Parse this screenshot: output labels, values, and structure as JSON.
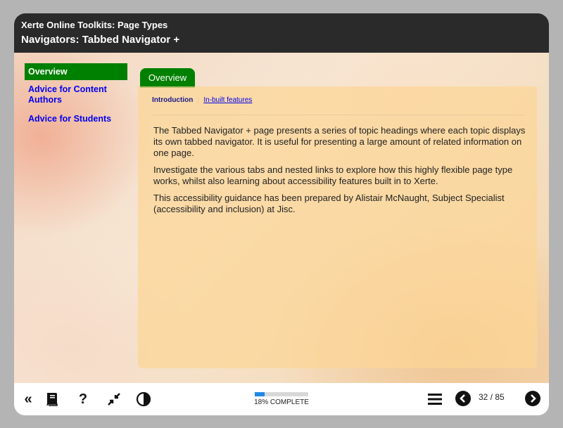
{
  "header": {
    "subtitle": "Xerte Online Toolkits: Page Types",
    "title": "Navigators: Tabbed Navigator +"
  },
  "sidebar": {
    "items": [
      {
        "label": "Overview",
        "active": true
      },
      {
        "label": "Advice for Content Authors",
        "active": false
      },
      {
        "label": "Advice for Students",
        "active": false
      }
    ]
  },
  "main": {
    "tab_label": "Overview",
    "subtabs": [
      {
        "label": "Introduction",
        "current": true
      },
      {
        "label": "In-built features",
        "current": false
      }
    ],
    "paragraphs": [
      "The Tabbed Navigator + page presents a series of topic headings where each topic displays its own tabbed navigator. It is useful for presenting a large amount of related information on one page.",
      "Investigate the various tabs and nested links to explore how this highly flexible page type works, whilst also learning about accessibility features built in to Xerte.",
      "This accessibility guidance has been prepared by Alistair McNaught, Subject Specialist (accessibility and inclusion) at Jisc."
    ]
  },
  "footer": {
    "icons": [
      "first-page-icon",
      "glossary-book-icon",
      "help-icon",
      "exit-fullscreen-icon",
      "contrast-icon",
      "menu-icon",
      "previous-page-icon",
      "next-page-icon"
    ],
    "progress_percent": 18,
    "progress_label": "18% COMPLETE",
    "page_counter": "32 / 85"
  },
  "colors": {
    "header_bg": "#2a2a2a",
    "accent_green": "#008000",
    "link_blue": "#0000ee",
    "progress_blue": "#1e88e5"
  }
}
